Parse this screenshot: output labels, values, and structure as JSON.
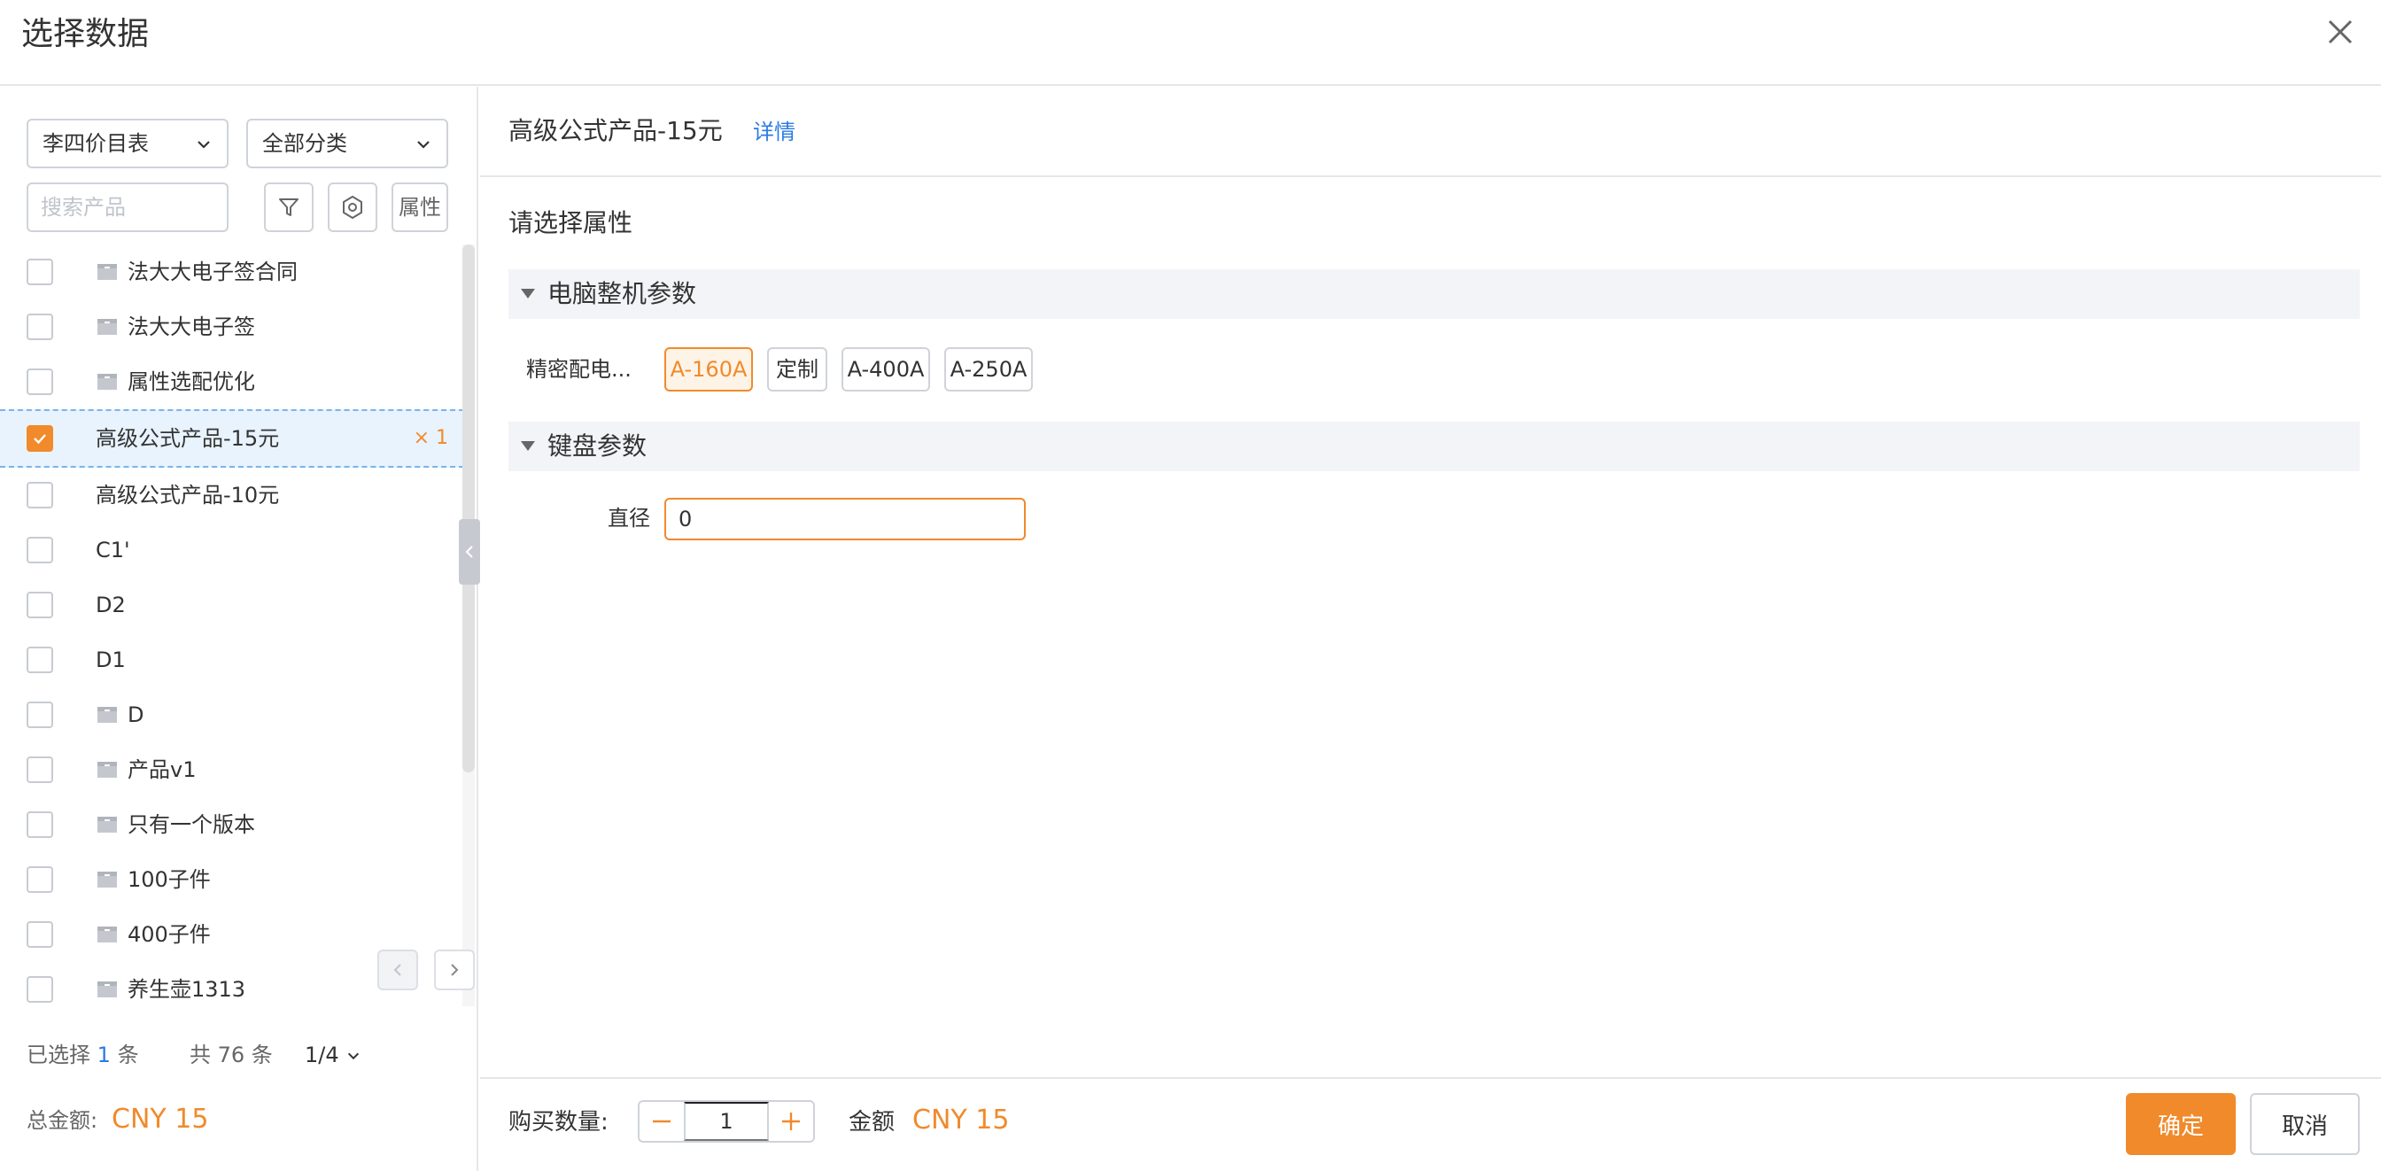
{
  "dialog": {
    "title": "选择数据",
    "close_icon": "close-icon"
  },
  "left": {
    "price_list": "李四价目表",
    "category": "全部分类",
    "search_placeholder": "搜索产品",
    "filter_icon": "filter-icon",
    "settings_icon": "settings-icon",
    "attr_label": "属性",
    "items": [
      {
        "label": "法大大电子签合同",
        "folder": true,
        "checked": false
      },
      {
        "label": "法大大电子签",
        "folder": true,
        "checked": false
      },
      {
        "label": "属性选配优化",
        "folder": true,
        "checked": false
      },
      {
        "label": "高级公式产品-15元",
        "folder": false,
        "checked": true,
        "qty": "× 1"
      },
      {
        "label": "高级公式产品-10元",
        "folder": false,
        "checked": false
      },
      {
        "label": "C1'",
        "folder": false,
        "checked": false
      },
      {
        "label": "D2",
        "folder": false,
        "checked": false
      },
      {
        "label": "D1",
        "folder": false,
        "checked": false
      },
      {
        "label": "D",
        "folder": true,
        "checked": false
      },
      {
        "label": "产品v1",
        "folder": true,
        "checked": false
      },
      {
        "label": "只有一个版本",
        "folder": true,
        "checked": false
      },
      {
        "label": "100子件",
        "folder": true,
        "checked": false
      },
      {
        "label": "400子件",
        "folder": true,
        "checked": false
      },
      {
        "label": "养生壶1313",
        "folder": true,
        "checked": false
      }
    ],
    "footer": {
      "selected_prefix": "已选择",
      "selected_count": "1",
      "selected_suffix": "条",
      "total_text": "共 76 条",
      "page": "1/4",
      "total_amount_label": "总金额:",
      "total_amount": "CNY 15"
    }
  },
  "right": {
    "product_title": "高级公式产品-15元",
    "detail_link": "详情",
    "prompt": "请选择属性",
    "sections": [
      {
        "title": "电脑整机参数"
      },
      {
        "title": "键盘参数"
      }
    ],
    "param1_label": "精密配电...",
    "options": [
      {
        "label": "A-160A",
        "active": true
      },
      {
        "label": "定制",
        "active": false
      },
      {
        "label": "A-400A",
        "active": false
      },
      {
        "label": "A-250A",
        "active": false
      }
    ],
    "param2_label": "直径",
    "param2_value": "0",
    "bottom": {
      "qty_label": "购买数量:",
      "qty_value": "1",
      "amount_label": "金额",
      "amount_value": "CNY 15",
      "confirm": "确定",
      "cancel": "取消"
    }
  },
  "colors": {
    "accent": "#f08a2b",
    "link": "#2b7be4",
    "selected_row": "#e8f3fd"
  }
}
